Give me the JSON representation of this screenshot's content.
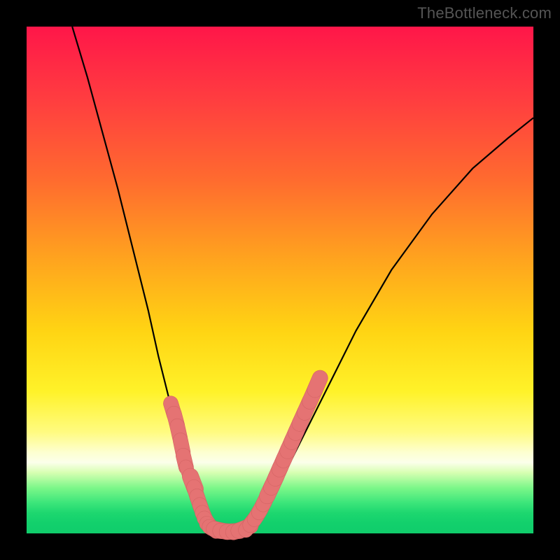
{
  "watermark": "TheBottleneck.com",
  "chart_data": {
    "type": "line",
    "title": "",
    "xlabel": "",
    "ylabel": "",
    "xlim": [
      0,
      100
    ],
    "ylim": [
      0,
      100
    ],
    "series": [
      {
        "name": "left-curve",
        "x": [
          9,
          12,
          15,
          18,
          21,
          24,
          26,
          28,
          30,
          31.5,
          33,
          34.2,
          35,
          35.8,
          36.5
        ],
        "y": [
          100,
          90,
          79,
          68,
          56,
          44,
          35,
          27,
          20,
          14,
          9,
          5,
          3,
          1.5,
          0.6
        ]
      },
      {
        "name": "valley-floor",
        "x": [
          36.5,
          38,
          40,
          42,
          43.5
        ],
        "y": [
          0.6,
          0.2,
          0.1,
          0.2,
          0.6
        ]
      },
      {
        "name": "right-curve",
        "x": [
          43.5,
          45,
          47,
          50,
          54,
          59,
          65,
          72,
          80,
          88,
          95,
          100
        ],
        "y": [
          0.6,
          2,
          5,
          10,
          18,
          28,
          40,
          52,
          63,
          72,
          78,
          82
        ]
      }
    ],
    "markers": [
      {
        "name": "left-bead-cluster",
        "points": [
          {
            "x": 28.8,
            "y": 24.5,
            "r": 1.6
          },
          {
            "x": 29.4,
            "y": 22.5,
            "r": 1.6
          },
          {
            "x": 30.0,
            "y": 20.0,
            "r": 1.6
          },
          {
            "x": 30.6,
            "y": 17.2,
            "r": 1.6
          },
          {
            "x": 31.2,
            "y": 14.2,
            "r": 1.6
          },
          {
            "x": 31.8,
            "y": 12.2,
            "r": 1.4
          },
          {
            "x": 32.8,
            "y": 10.0,
            "r": 1.8
          },
          {
            "x": 33.4,
            "y": 8.0,
            "r": 1.6
          },
          {
            "x": 34.0,
            "y": 6.2,
            "r": 1.6
          },
          {
            "x": 34.6,
            "y": 4.5,
            "r": 1.6
          },
          {
            "x": 35.2,
            "y": 3.0,
            "r": 1.6
          },
          {
            "x": 35.8,
            "y": 2.0,
            "r": 1.6
          },
          {
            "x": 36.5,
            "y": 1.2,
            "r": 1.6
          },
          {
            "x": 37.2,
            "y": 0.9,
            "r": 1.6
          },
          {
            "x": 38.2,
            "y": 0.6,
            "r": 1.7
          },
          {
            "x": 39.5,
            "y": 0.4,
            "r": 1.7
          },
          {
            "x": 40.8,
            "y": 0.4,
            "r": 1.7
          },
          {
            "x": 42.0,
            "y": 0.6,
            "r": 1.7
          },
          {
            "x": 43.0,
            "y": 1.0,
            "r": 1.7
          }
        ]
      },
      {
        "name": "right-bead-cluster",
        "points": [
          {
            "x": 44.0,
            "y": 1.6,
            "r": 1.6
          },
          {
            "x": 44.8,
            "y": 2.6,
            "r": 1.6
          },
          {
            "x": 45.6,
            "y": 3.8,
            "r": 1.6
          },
          {
            "x": 46.4,
            "y": 5.2,
            "r": 1.6
          },
          {
            "x": 47.2,
            "y": 6.8,
            "r": 1.6
          },
          {
            "x": 48.0,
            "y": 8.5,
            "r": 1.7
          },
          {
            "x": 48.8,
            "y": 10.2,
            "r": 1.7
          },
          {
            "x": 49.6,
            "y": 12.0,
            "r": 1.7
          },
          {
            "x": 50.4,
            "y": 13.8,
            "r": 1.7
          },
          {
            "x": 51.2,
            "y": 15.6,
            "r": 1.7
          },
          {
            "x": 52.0,
            "y": 17.4,
            "r": 1.7
          },
          {
            "x": 52.8,
            "y": 19.2,
            "r": 1.7
          },
          {
            "x": 53.6,
            "y": 21.0,
            "r": 1.7
          },
          {
            "x": 54.4,
            "y": 22.8,
            "r": 1.7
          },
          {
            "x": 55.4,
            "y": 25.0,
            "r": 1.7
          },
          {
            "x": 56.4,
            "y": 27.2,
            "r": 1.7
          },
          {
            "x": 57.4,
            "y": 29.5,
            "r": 1.7
          }
        ]
      }
    ],
    "background_gradient": {
      "direction": "top-to-bottom",
      "stops": [
        {
          "pos": 0,
          "color": "#ff1649"
        },
        {
          "pos": 30,
          "color": "#ff6a2f"
        },
        {
          "pos": 60,
          "color": "#ffd413"
        },
        {
          "pos": 84,
          "color": "#fdffd0"
        },
        {
          "pos": 100,
          "color": "#10cd6b"
        }
      ]
    }
  }
}
